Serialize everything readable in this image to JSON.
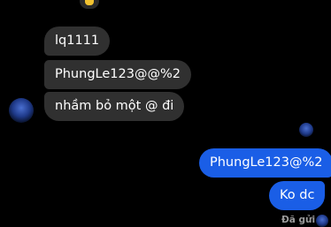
{
  "conversation": {
    "incoming_messages": [
      {
        "text": "lq1111"
      },
      {
        "text": "PhungLe123@@%2"
      },
      {
        "text": "nhầm bỏ một @ đi"
      }
    ],
    "outgoing_messages": [
      {
        "text": "PhungLe123@%2"
      },
      {
        "text": "Ko dc"
      }
    ],
    "delivery_status": "Đã gửi"
  },
  "colors": {
    "background": "#000000",
    "incoming_bubble": "#303030",
    "outgoing_bubble": "#1a5ee6",
    "text": "#ffffff",
    "status_text": "#9a9a9a"
  },
  "icons": {
    "reaction": "thumbs-up-icon",
    "contact_avatar": "avatar"
  }
}
